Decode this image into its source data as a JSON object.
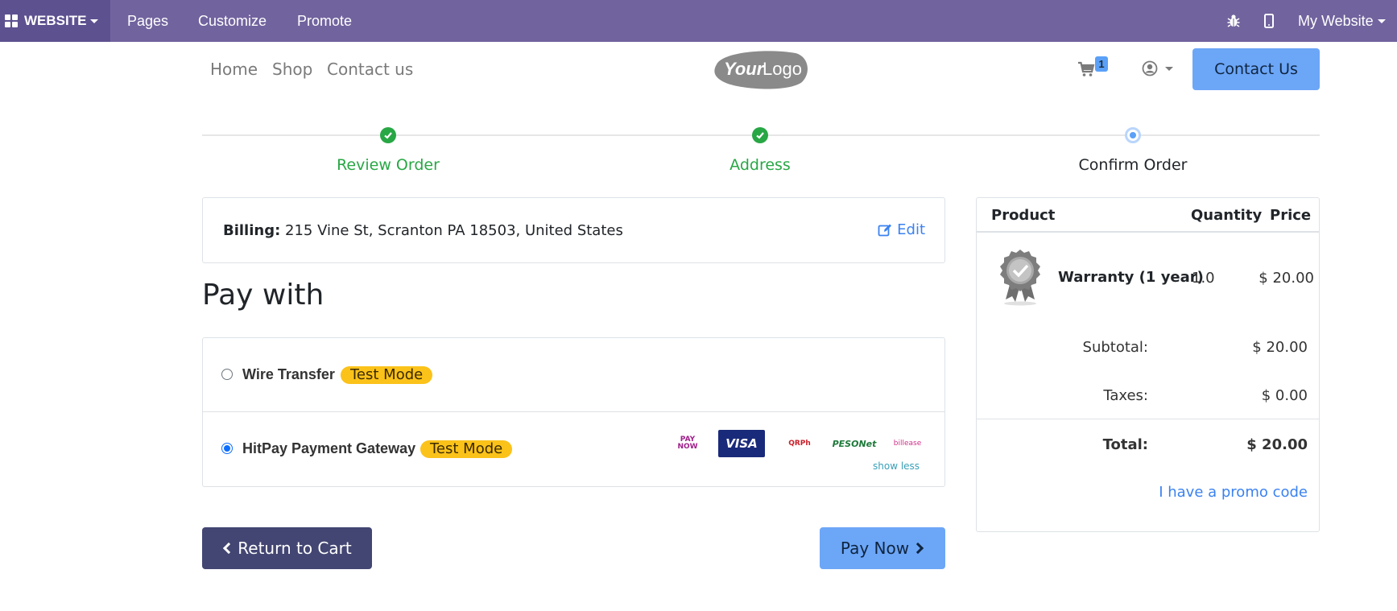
{
  "admin_bar": {
    "apps_label": "WEBSITE",
    "menu": [
      "Pages",
      "Customize",
      "Promote"
    ],
    "site_switcher": "My Website",
    "icons": [
      "bug-icon",
      "mobile-icon"
    ]
  },
  "header": {
    "nav": [
      "Home",
      "Shop",
      "Contact us"
    ],
    "logo_text": "YourLogo",
    "cart_count": "1",
    "contact_button": "Contact Us"
  },
  "wizard": {
    "steps": [
      {
        "label": "Review Order",
        "state": "done"
      },
      {
        "label": "Address",
        "state": "done"
      },
      {
        "label": "Confirm Order",
        "state": "current"
      }
    ]
  },
  "billing": {
    "label": "Billing:",
    "address": "215 Vine St, Scranton PA 18503, United States",
    "edit_label": "Edit"
  },
  "payment": {
    "title": "Pay with",
    "methods": [
      {
        "name": "Wire Transfer",
        "badge": "Test Mode",
        "selected": false
      },
      {
        "name": "HitPay Payment Gateway",
        "badge": "Test Mode",
        "selected": true
      }
    ],
    "provider_icons": [
      "PAY NOW",
      "VISA",
      "QRPh",
      "PESONet",
      "billease"
    ],
    "show_less": "show less"
  },
  "actions": {
    "return_label": "Return to Cart",
    "pay_label": "Pay Now"
  },
  "summary": {
    "headers": {
      "product": "Product",
      "quantity": "Quantity",
      "price": "Price"
    },
    "item": {
      "name": "Warranty (1 year)",
      "quantity": "1.0",
      "price": "$ 20.00"
    },
    "subtotal_label": "Subtotal:",
    "subtotal": "$ 20.00",
    "taxes_label": "Taxes:",
    "taxes": "$ 0.00",
    "total_label": "Total:",
    "total": "$ 20.00",
    "promo_label": "I have a promo code"
  },
  "colors": {
    "admin_bar": "#71639e",
    "accent_blue": "#6ca6f7",
    "success": "#28a745",
    "badge": "#fbc21a",
    "return_button": "#434672"
  }
}
